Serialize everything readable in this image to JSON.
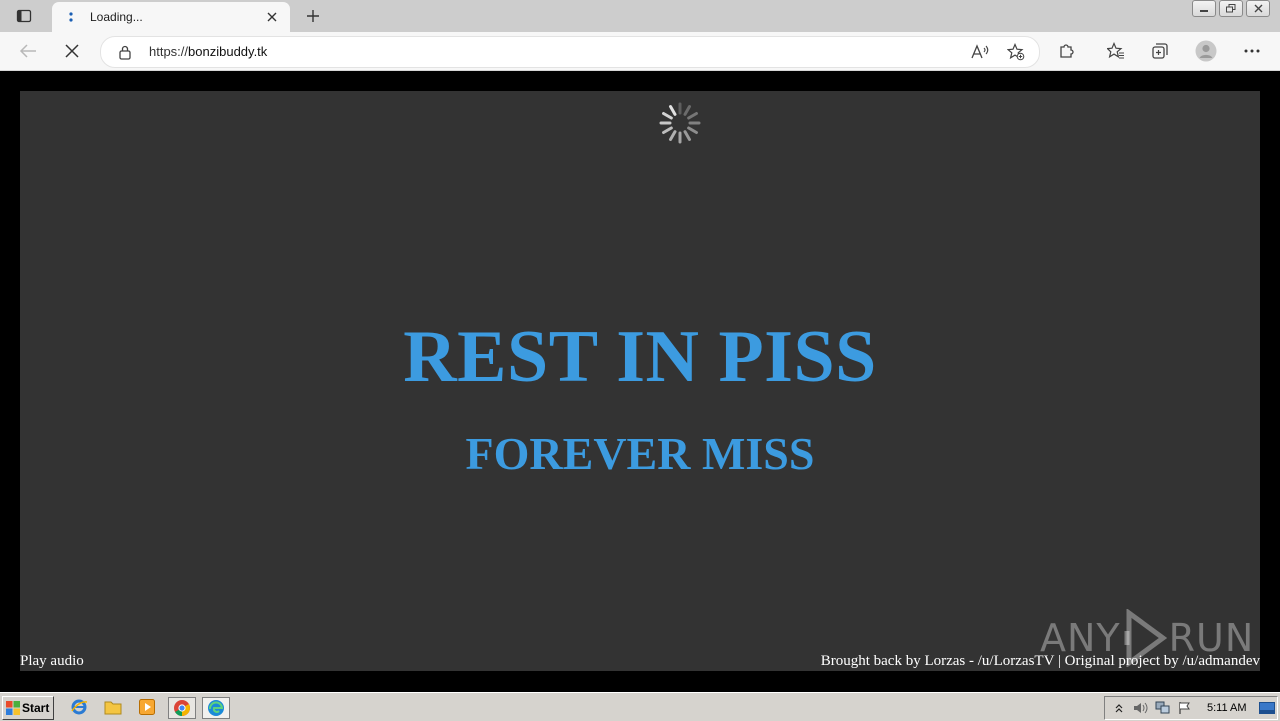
{
  "browser": {
    "tab": {
      "title": "Loading..."
    },
    "address": {
      "scheme": "https://",
      "host": "bonzibuddy.tk"
    }
  },
  "page": {
    "headline": "REST IN PISS",
    "subline": "FOREVER MISS",
    "play_audio": "Play audio",
    "credits": "Brought back by Lorzas - /u/LorzasTV | Original project by /u/admandev",
    "watermark": {
      "left": "ANY",
      "right": "RUN"
    }
  },
  "taskbar": {
    "start_label": "Start",
    "clock": "5:11 AM"
  },
  "colors": {
    "accent_text": "#3c9be0",
    "stage_bg": "#333333",
    "page_bg": "#000000"
  }
}
